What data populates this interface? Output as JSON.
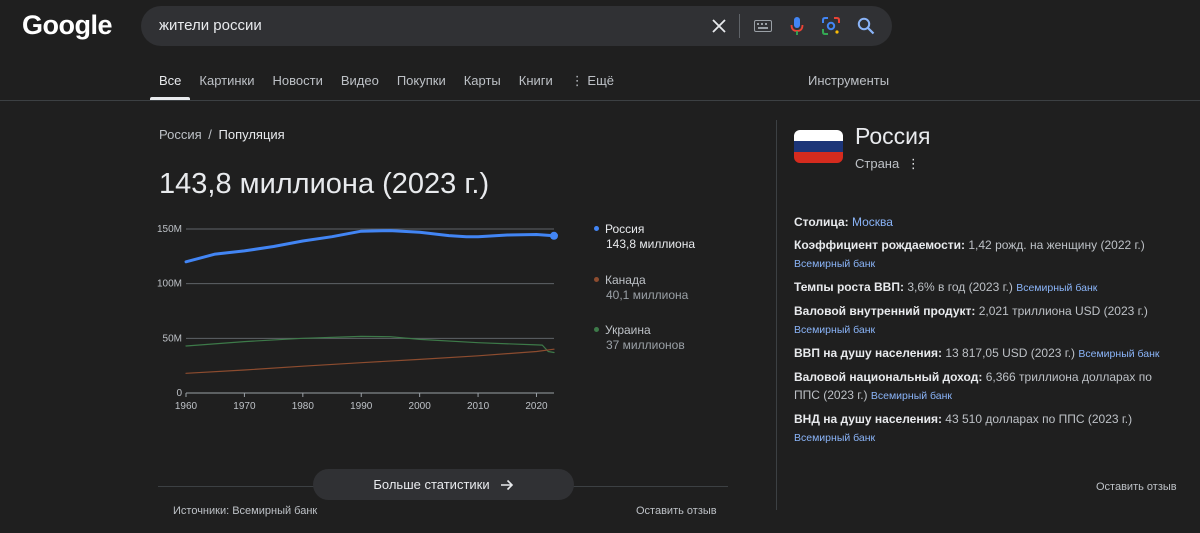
{
  "header": {
    "logo": "Google",
    "query": "жители россии"
  },
  "tabs": [
    {
      "label": "Все",
      "active": true
    },
    {
      "label": "Картинки"
    },
    {
      "label": "Новости"
    },
    {
      "label": "Видео"
    },
    {
      "label": "Покупки"
    },
    {
      "label": "Карты"
    },
    {
      "label": "Книги"
    },
    {
      "label": "⋮ Ещё"
    }
  ],
  "tools_label": "Инструменты",
  "breadcrumb": {
    "parent": "Россия",
    "sep": "/",
    "current": "Популяция"
  },
  "headline_value": "143,8 миллиона (2023 г.)",
  "chart_data": {
    "type": "line",
    "x_ticks": [
      "1960",
      "1970",
      "1980",
      "1990",
      "2000",
      "2010",
      "2020"
    ],
    "y_ticks": [
      "0",
      "50M",
      "100M",
      "150M"
    ],
    "ylim": [
      0,
      150
    ],
    "xlim": [
      1960,
      2023
    ],
    "series": [
      {
        "name": "Россия",
        "label": "143,8 миллиона",
        "color": "#4285f4",
        "points": [
          [
            1960,
            120
          ],
          [
            1965,
            127
          ],
          [
            1970,
            130
          ],
          [
            1975,
            134
          ],
          [
            1980,
            139
          ],
          [
            1985,
            143
          ],
          [
            1990,
            148
          ],
          [
            1995,
            148.5
          ],
          [
            2000,
            147
          ],
          [
            2005,
            144
          ],
          [
            2008,
            143
          ],
          [
            2010,
            143
          ],
          [
            2015,
            144.5
          ],
          [
            2020,
            145
          ],
          [
            2023,
            143.8
          ]
        ]
      },
      {
        "name": "Канада",
        "label": "40,1 миллиона",
        "color": "#8d4c2f",
        "points": [
          [
            1960,
            18
          ],
          [
            1970,
            21
          ],
          [
            1980,
            24.5
          ],
          [
            1990,
            27.7
          ],
          [
            2000,
            30.7
          ],
          [
            2010,
            34
          ],
          [
            2020,
            38
          ],
          [
            2023,
            40.1
          ]
        ]
      },
      {
        "name": "Украина",
        "label": "37 миллионов",
        "color": "#3d7a49",
        "points": [
          [
            1960,
            43
          ],
          [
            1970,
            47
          ],
          [
            1980,
            50
          ],
          [
            1990,
            51.8
          ],
          [
            1995,
            51.5
          ],
          [
            2000,
            49
          ],
          [
            2010,
            46
          ],
          [
            2020,
            44
          ],
          [
            2021,
            43.8
          ],
          [
            2022,
            38
          ],
          [
            2023,
            37
          ]
        ]
      }
    ]
  },
  "more_stats_label": "Больше статистики",
  "sources_label": "Источники: Всемирный банк",
  "feedback_label": "Оставить отзыв",
  "kp": {
    "title": "Россия",
    "subtitle": "Страна",
    "facts": [
      {
        "label": "Столица:",
        "value": "",
        "link": "Москва",
        "src": ""
      },
      {
        "label": "Коэффициент рождаемости:",
        "value": "1,42 рожд. на женщину (2022 г.)",
        "link": "",
        "src": "Всемирный банк"
      },
      {
        "label": "Темпы роста ВВП:",
        "value": "3,6% в год (2023 г.)",
        "link": "",
        "src": "Всемирный банк"
      },
      {
        "label": "Валовой внутренний продукт:",
        "value": "2,021 триллиона USD (2023 г.)",
        "link": "",
        "src": "Всемирный банк"
      },
      {
        "label": "ВВП на душу населения:",
        "value": "13 817,05 USD (2023 г.)",
        "link": "",
        "src": "Всемирный банк"
      },
      {
        "label": "Валовой национальный доход:",
        "value": "6,366 триллиона долларах по ППС (2023 г.)",
        "link": "",
        "src": "Всемирный банк"
      },
      {
        "label": "ВНД на душу населения:",
        "value": "43 510 долларах по ППС (2023 г.)",
        "link": "",
        "src": "Всемирный банк"
      }
    ],
    "feedback_label": "Оставить отзыв"
  },
  "colors": {
    "accent": "#8ab4f8",
    "bg": "#1f1f1f"
  }
}
